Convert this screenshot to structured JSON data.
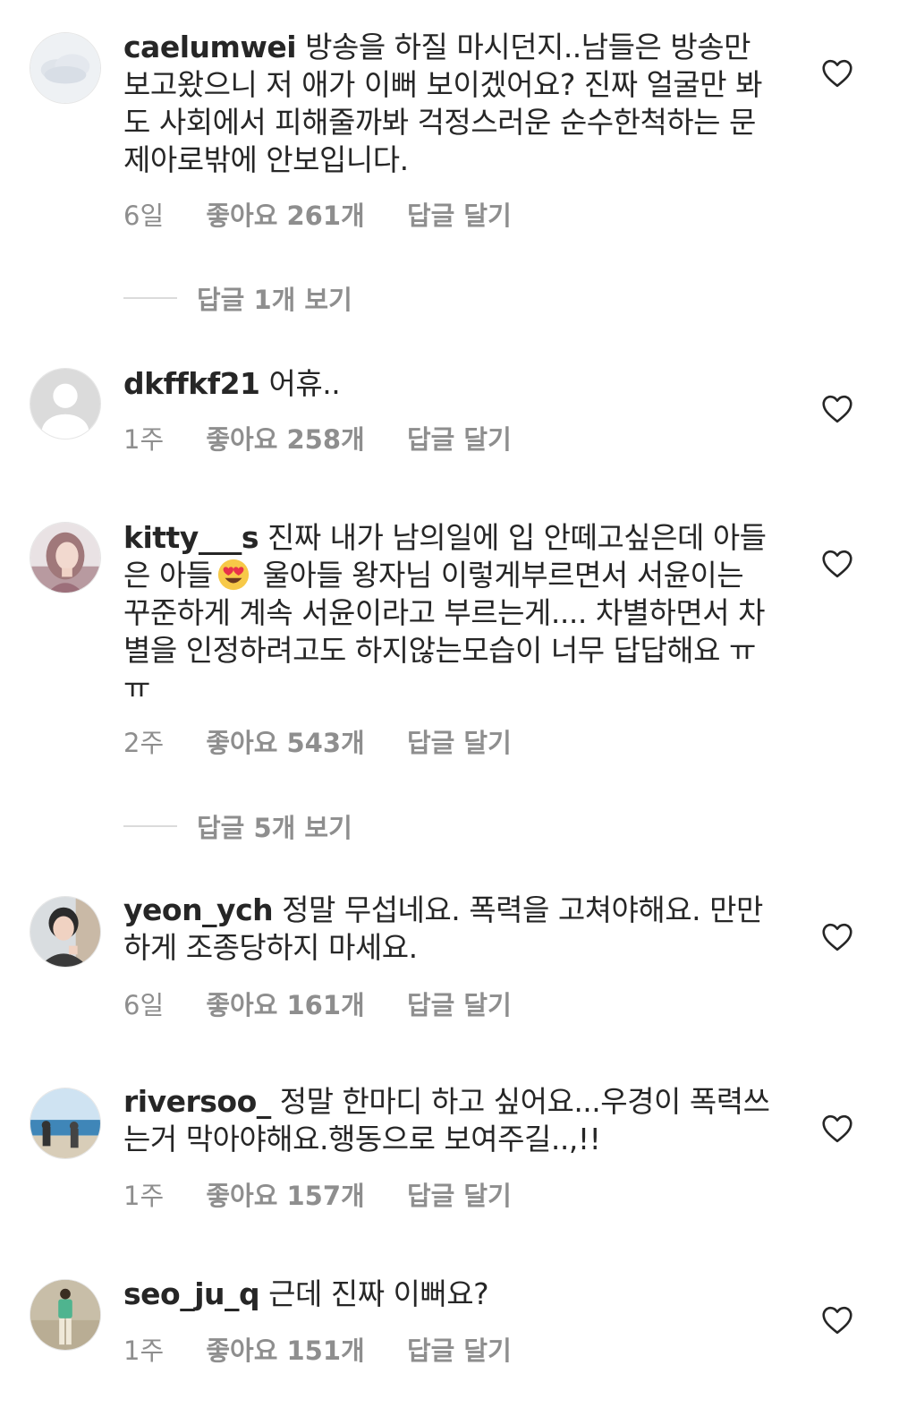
{
  "colors": {
    "text": "#262626",
    "meta": "#8e8e8e",
    "divider": "#dbdbdb"
  },
  "comments": [
    {
      "username": "caelumwei",
      "text": "방송을 하질 마시던지..남들은 방송만 보고왔으니 저 애가 이뻐 보이겠어요? 진짜 얼굴만 봐도 사회에서 피해줄까봐 걱정스러운 순수한척하는 문제아로밖에 안보입니다.",
      "time": "6일",
      "likes": "좋아요 261개",
      "reply": "답글 달기",
      "view_replies": "답글 1개 보기",
      "avatar_icon": "cloud-avatar-icon"
    },
    {
      "username": "dkffkf21",
      "text": "어휴..",
      "time": "1주",
      "likes": "좋아요 258개",
      "reply": "답글 달기",
      "avatar_icon": "default-user-avatar-icon"
    },
    {
      "username": "kitty___s",
      "text_before_emoji": "진짜 내가 남의일에 입 안떼고싶은데 아들은 아들",
      "emoji": "heart-eyes-emoji",
      "text_after_emoji": " 울아들 왕자님 이렇게부르면서 서윤이는 꾸준하게 계속 서윤이라고 부르는게.... 차별하면서 차별을 인정하려고도 하지않는모습이 너무 답답해요 ㅠㅠ",
      "time": "2주",
      "likes": "좋아요 543개",
      "reply": "답글 달기",
      "view_replies": "답글 5개 보기",
      "avatar_icon": "girl-photo-avatar-icon"
    },
    {
      "username": "yeon_ych",
      "text": "정말 무섭네요. 폭력을 고쳐야해요. 만만하게 조종당하지 마세요.",
      "time": "6일",
      "likes": "좋아요 161개",
      "reply": "답글 달기",
      "avatar_icon": "boy-photo-avatar-icon"
    },
    {
      "username": "riversoo_",
      "text": "정말 한마디 하고 싶어요...우경이 폭력쓰는거 막아야해요.행동으로 보여주길..,!!",
      "time": "1주",
      "likes": "좋아요 157개",
      "reply": "답글 달기",
      "avatar_icon": "beach-photo-avatar-icon"
    },
    {
      "username": "seo_ju_q",
      "text": "근데 진짜 이뻐요?",
      "time": "1주",
      "likes": "좋아요 151개",
      "reply": "답글 달기",
      "avatar_icon": "fashion-photo-avatar-icon"
    }
  ]
}
